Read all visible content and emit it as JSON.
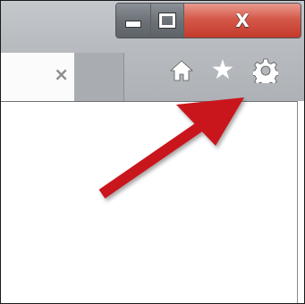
{
  "window_controls": {
    "minimize": "minimize",
    "maximize": "maximize",
    "close": "close"
  },
  "tab": {
    "close_glyph": "×"
  },
  "toolbar": {
    "icons": [
      "home-icon",
      "star-icon",
      "gear-icon"
    ],
    "star_glyph": "★"
  },
  "annotation": {
    "arrow_color": "#c8161d",
    "points_to": "gear-icon"
  },
  "colors": {
    "close_button": "#d5594a",
    "toolbar_icon": "#ffffff"
  }
}
